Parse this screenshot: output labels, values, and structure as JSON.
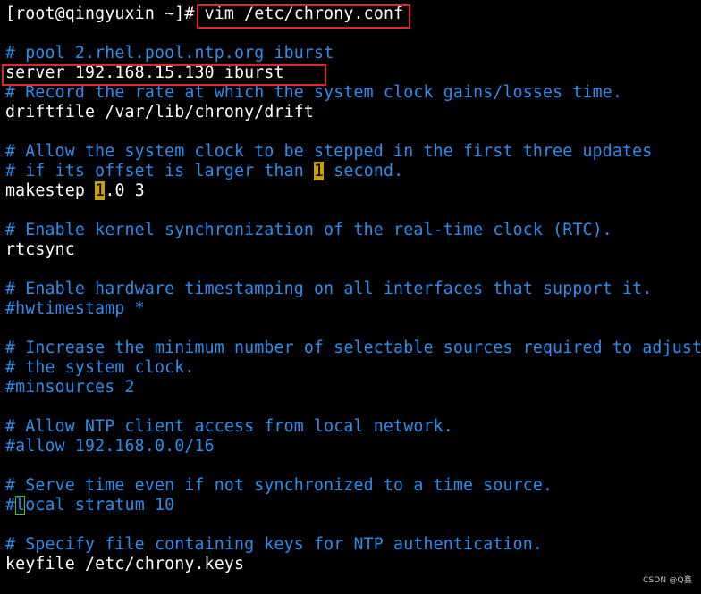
{
  "terminal": {
    "prompt": "[root@qingyuxin ~]#",
    "command": "vim /etc/chrony.conf",
    "lines": [
      "# pool 2.rhel.pool.ntp.org iburst",
      "server 192.168.15.130 iburst",
      "# Record the rate at which the system clock gains/losses time.",
      "driftfile /var/lib/chrony/drift",
      "",
      "# Allow the system clock to be stepped in the first three updates",
      "# if its offset is larger than ",
      "1",
      " second.",
      "makestep ",
      "1",
      ".0 3",
      "",
      "# Enable kernel synchronization of the real-time clock (RTC).",
      "rtcsync",
      "",
      "# Enable hardware timestamping on all interfaces that support it.",
      "#hwtimestamp *",
      "",
      "# Increase the minimum number of selectable sources required to adjust",
      "# the system clock.",
      "#minsources 2",
      "",
      "# Allow NTP client access from local network.",
      "#allow 192.168.0.0/16",
      "",
      "# Serve time even if not synchronized to a time source.",
      "#",
      "l",
      "ocal stratum 10",
      "",
      "# Specify file containing keys for NTP authentication.",
      "keyfile /etc/chrony.keys"
    ]
  },
  "watermark": "CSDN @Q鑫",
  "colors": {
    "background": "#000000",
    "text": "#ffffff",
    "comment": "#2d8cf0",
    "match_highlight": "#c8a000",
    "cursor": "#32c832",
    "annotation": "#e0252b"
  }
}
